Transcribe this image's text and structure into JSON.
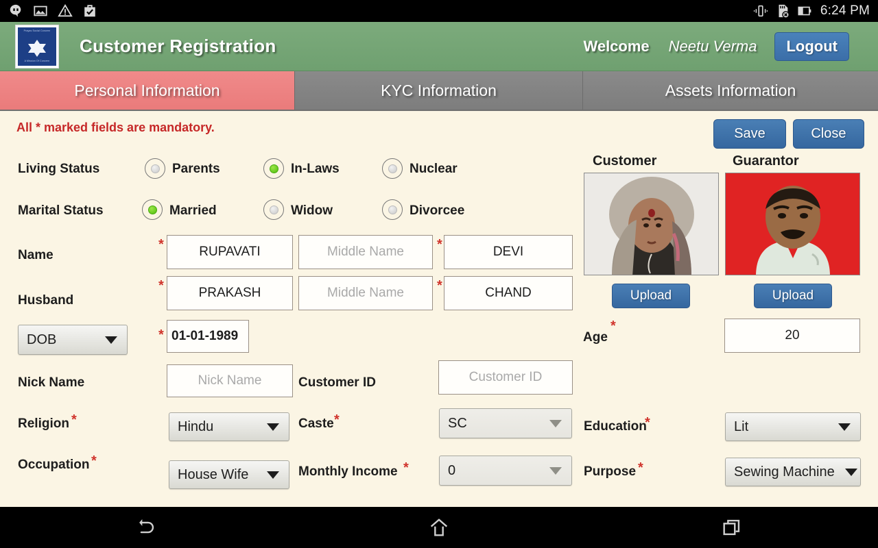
{
  "statusbar": {
    "icons": [
      "hangouts-icon",
      "image-icon",
      "warning-icon",
      "checked-bag-icon"
    ],
    "right_icons": [
      "vibrate-icon",
      "sdcard-removed-icon",
      "battery-icon"
    ],
    "time": "6:24 PM"
  },
  "header": {
    "logo_alt": "prayas-logo",
    "logo_caption": "Prayas Social Concern",
    "logo_footer": "A Mission Of Concern",
    "title": "Customer Registration",
    "welcome_label": "Welcome",
    "user_name": "Neetu Verma",
    "logout_label": "Logout",
    "bg_color": "#7cab7c",
    "logout_color": "#3b6ea8"
  },
  "tabs": [
    {
      "label": "Personal Information",
      "active": true
    },
    {
      "label": "KYC Information",
      "active": false
    },
    {
      "label": "Assets Information",
      "active": false
    }
  ],
  "tab_colors": {
    "active": "#ef8686",
    "inactive": "#828282"
  },
  "toolbar": {
    "mandatory_notice": "All * marked fields are mandatory.",
    "save_label": "Save",
    "close_label": "Close",
    "notice_color": "#c62828",
    "button_color": "#3b6ea8"
  },
  "form": {
    "living_status": {
      "label": "Living Status",
      "options": [
        {
          "label": "Parents",
          "selected": false
        },
        {
          "label": "In-Laws",
          "selected": true
        },
        {
          "label": "Nuclear",
          "selected": false
        }
      ]
    },
    "marital_status": {
      "label": "Marital Status",
      "options": [
        {
          "label": "Married",
          "selected": true
        },
        {
          "label": "Widow",
          "selected": false
        },
        {
          "label": "Divorcee",
          "selected": false
        }
      ]
    },
    "name": {
      "label": "Name",
      "first_value": "RUPAVATI",
      "middle_placeholder": "Middle Name",
      "middle_value": "",
      "last_value": "DEVI"
    },
    "husband": {
      "label": "Husband",
      "first_value": "PRAKASH",
      "middle_placeholder": "Middle Name",
      "middle_value": "",
      "last_value": "CHAND"
    },
    "dob": {
      "select_label": "DOB",
      "value": "01-01-1989"
    },
    "age": {
      "label": "Age",
      "value": "20"
    },
    "nick_name": {
      "label": "Nick Name",
      "placeholder": "Nick Name",
      "value": ""
    },
    "customer_id": {
      "label": "Customer ID",
      "placeholder": "Customer ID",
      "value": ""
    },
    "religion": {
      "label": "Religion",
      "value": "Hindu"
    },
    "caste": {
      "label": "Caste",
      "value": "SC"
    },
    "education": {
      "label": "Education",
      "value": "Lit"
    },
    "occupation": {
      "label": "Occupation",
      "value": "House Wife"
    },
    "monthly_income": {
      "label": "Monthly Income",
      "value": "0"
    },
    "purpose": {
      "label": "Purpose",
      "value": "Sewing Machine"
    },
    "required_marker": "*"
  },
  "photos": {
    "customer": {
      "label": "Customer",
      "upload_label": "Upload"
    },
    "guarantor": {
      "label": "Guarantor",
      "upload_label": "Upload"
    }
  },
  "navbar": {
    "back": "back-icon",
    "home": "home-icon",
    "recents": "recents-icon"
  }
}
